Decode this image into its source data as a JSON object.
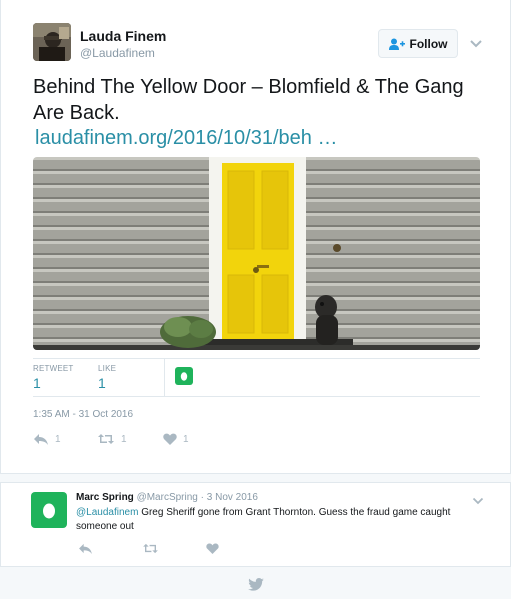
{
  "tweet": {
    "author_name": "Lauda Finem",
    "author_handle": "@Laudafinem",
    "follow_label": "Follow",
    "text": "Behind The Yellow Door – Blomfield & The Gang Are Back.",
    "link_text": "laudafinem.org/2016/10/31/beh …",
    "stats": {
      "retweet_label": "RETWEET",
      "retweet_count": "1",
      "like_label": "LIKE",
      "like_count": "1"
    },
    "timestamp": "1:35 AM - 31 Oct 2016",
    "actions": {
      "reply_count": "1",
      "retweet_count": "1",
      "like_count": "1"
    }
  },
  "reply": {
    "author_name": "Marc Spring",
    "author_handle": "@MarcSpring",
    "separator": "·",
    "date": "3 Nov 2016",
    "mention": "@Laudafinem",
    "text": " Greg Sheriff gone from Grant Thornton. Guess the fraud game caught someone out"
  },
  "colors": {
    "link": "#2a8fa6",
    "muted": "#8899a6",
    "egg_green": "#1fb35b",
    "door_yellow": "#f5d90a",
    "siding": "#9a9a94"
  },
  "icons": {
    "follow": "person-plus-icon",
    "reply": "reply-arrow-icon",
    "retweet": "retweet-icon",
    "like": "heart-icon",
    "more": "chevron-down-icon",
    "footer": "twitter-bird-icon"
  }
}
